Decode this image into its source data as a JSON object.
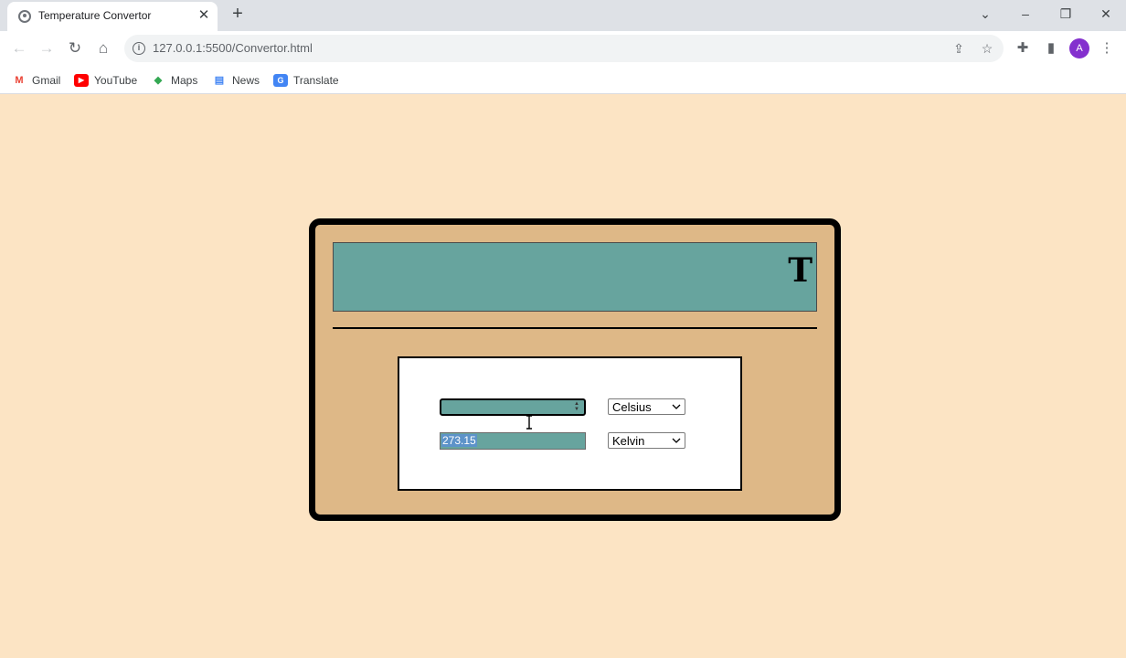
{
  "browser": {
    "tab_title": "Temperature Convertor",
    "tab_close": "✕",
    "new_tab": "+",
    "url": "127.0.0.1:5500/Convertor.html",
    "avatar_initial": "A",
    "window_controls": {
      "tab_search": "⌄",
      "minimize": "–",
      "restore": "❐",
      "close": "✕"
    },
    "bookmarks": [
      {
        "label": "Gmail",
        "icon": "gmail-icon"
      },
      {
        "label": "YouTube",
        "icon": "youtube-icon"
      },
      {
        "label": "Maps",
        "icon": "maps-icon"
      },
      {
        "label": "News",
        "icon": "news-icon"
      },
      {
        "label": "Translate",
        "icon": "translate-icon"
      }
    ]
  },
  "page": {
    "header_letter": "T",
    "input_value": "",
    "from_unit": "Celsius",
    "output_value": "273.15",
    "to_unit": "Kelvin"
  },
  "colors": {
    "page_background": "#fce4c4",
    "card_background": "#deb887",
    "panel_teal": "#67a49e",
    "selection_highlight": "#5d93c9",
    "avatar": "#8430ce"
  }
}
